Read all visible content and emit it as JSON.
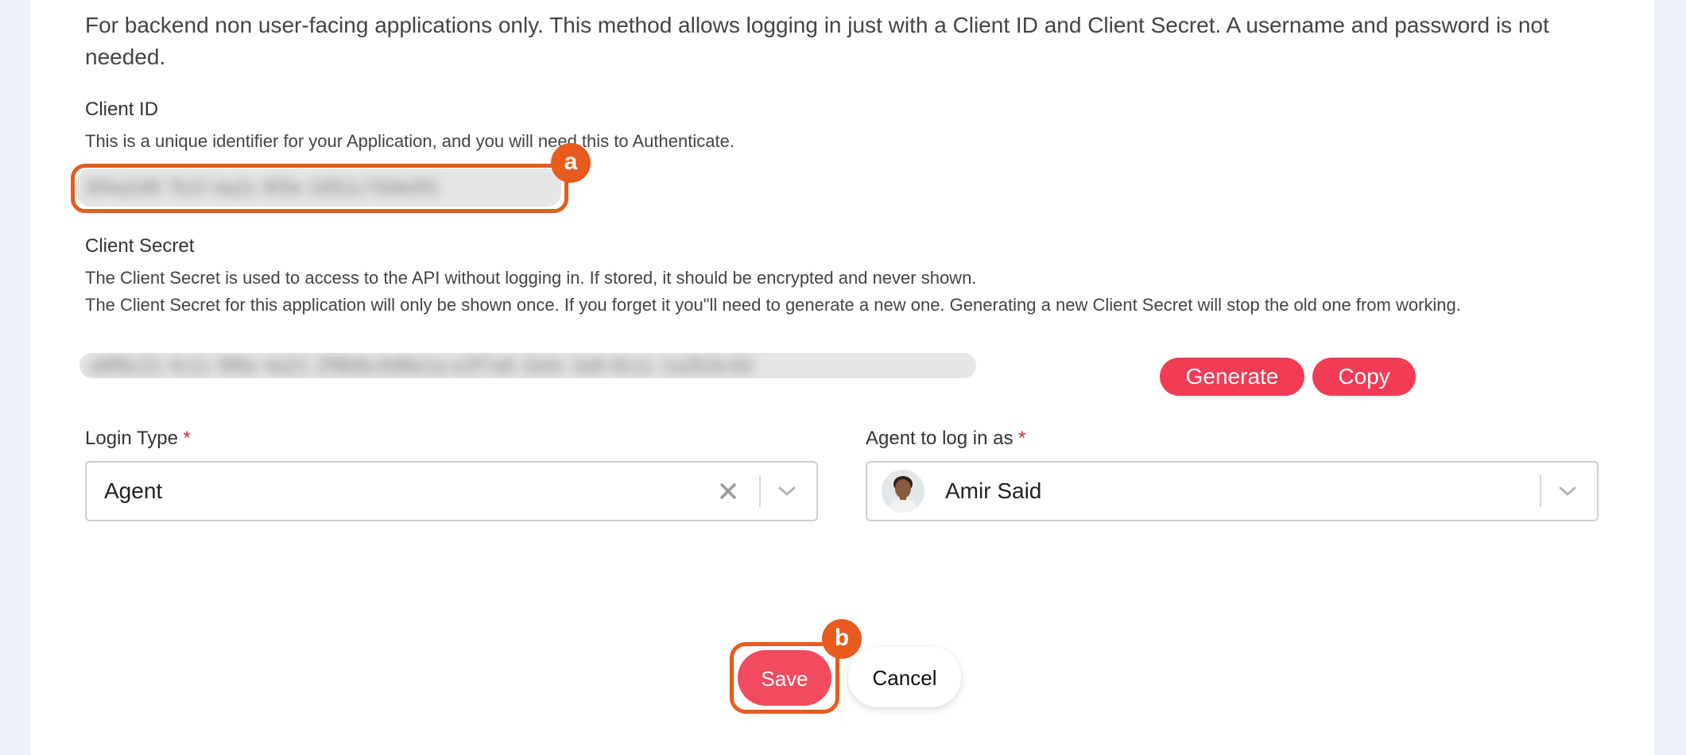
{
  "intro": {
    "text": "For backend non user-facing applications only. This method allows logging in just with a Client ID and Client Secret. A username and password is not needed."
  },
  "client_id": {
    "label": "Client ID",
    "help": "This is a unique identifier for your Application, and you will need this to Authenticate.",
    "value_masked": "6f4a2d9 7b1f 4a2c 9f3e 2d51c7b9e0f1",
    "callout_badge": "a"
  },
  "client_secret": {
    "label": "Client Secret",
    "help_line1": "The Client Secret is used to access to the API without logging in. If stored, it should be encrypted and never shown.",
    "help_line2": "The Client Secret for this application will only be shown once. If you forget it you\"ll need to generate a new one. Generating a new Client Secret will stop the old one from working.",
    "value_masked": "a8f6c21 4c1c 9f6e 4a21 2f9b6c4d8e1a e2f7a6 1b4c 3a9 8c1c 1a2b3c4d",
    "generate_label": "Generate",
    "copy_label": "Copy"
  },
  "login_type": {
    "label": "Login Type",
    "required_mark": "*",
    "value": "Agent"
  },
  "agent": {
    "label": "Agent to log in as",
    "required_mark": "*",
    "value": "Amir Said"
  },
  "actions": {
    "save_label": "Save",
    "cancel_label": "Cancel",
    "callout_badge": "b"
  },
  "colors": {
    "accent": "#f23c55",
    "callout": "#e85a1e",
    "required": "#e0243a"
  },
  "icons": {
    "clear": "close-icon",
    "dropdown": "chevron-down-icon"
  }
}
